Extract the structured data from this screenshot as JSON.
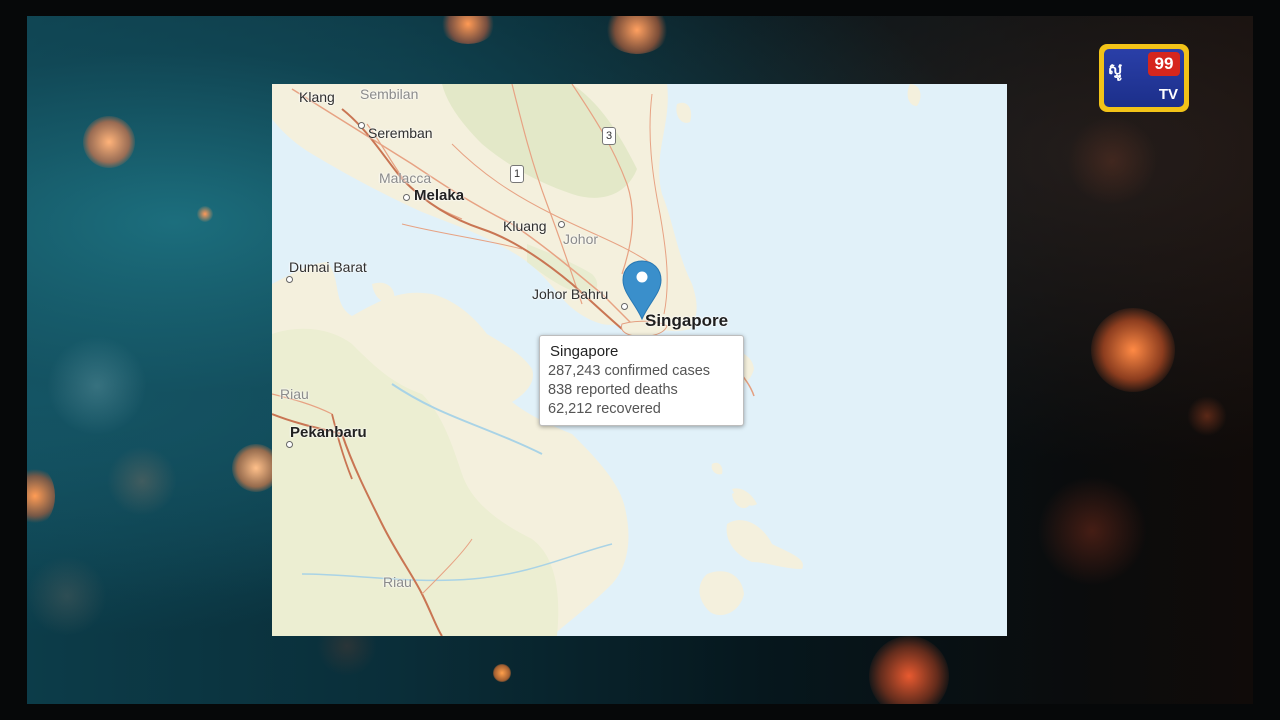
{
  "map": {
    "labels": {
      "klang": "Klang",
      "sembilan": "Sembilan",
      "seremban": "Seremban",
      "malacca": "Malacca",
      "melaka": "Melaka",
      "kluang": "Kluang",
      "johor": "Johor",
      "dumai_barat": "Dumai Barat",
      "johor_bahru": "Johor Bahru",
      "singapore": "Singapore",
      "riau_north": "Riau",
      "pekanbaru": "Pekanbaru",
      "riau_south": "Riau"
    },
    "route_shields": [
      "3",
      "1"
    ],
    "colors": {
      "water": "#e1f1f9",
      "land": "#f4f0dd",
      "vegetation": "#e6ebcc",
      "roads": "#e8a080",
      "highway": "#c8714f",
      "marker": "#3a8fcb"
    },
    "marker_icon": "location-pin-icon"
  },
  "popup": {
    "title": "Singapore",
    "confirmed": "287,243 confirmed cases",
    "deaths": "838 reported deaths",
    "recovered": "62,212 recovered"
  },
  "logo": {
    "badge": "99",
    "tv": "TV",
    "wordmark": "ស្ទូ"
  }
}
